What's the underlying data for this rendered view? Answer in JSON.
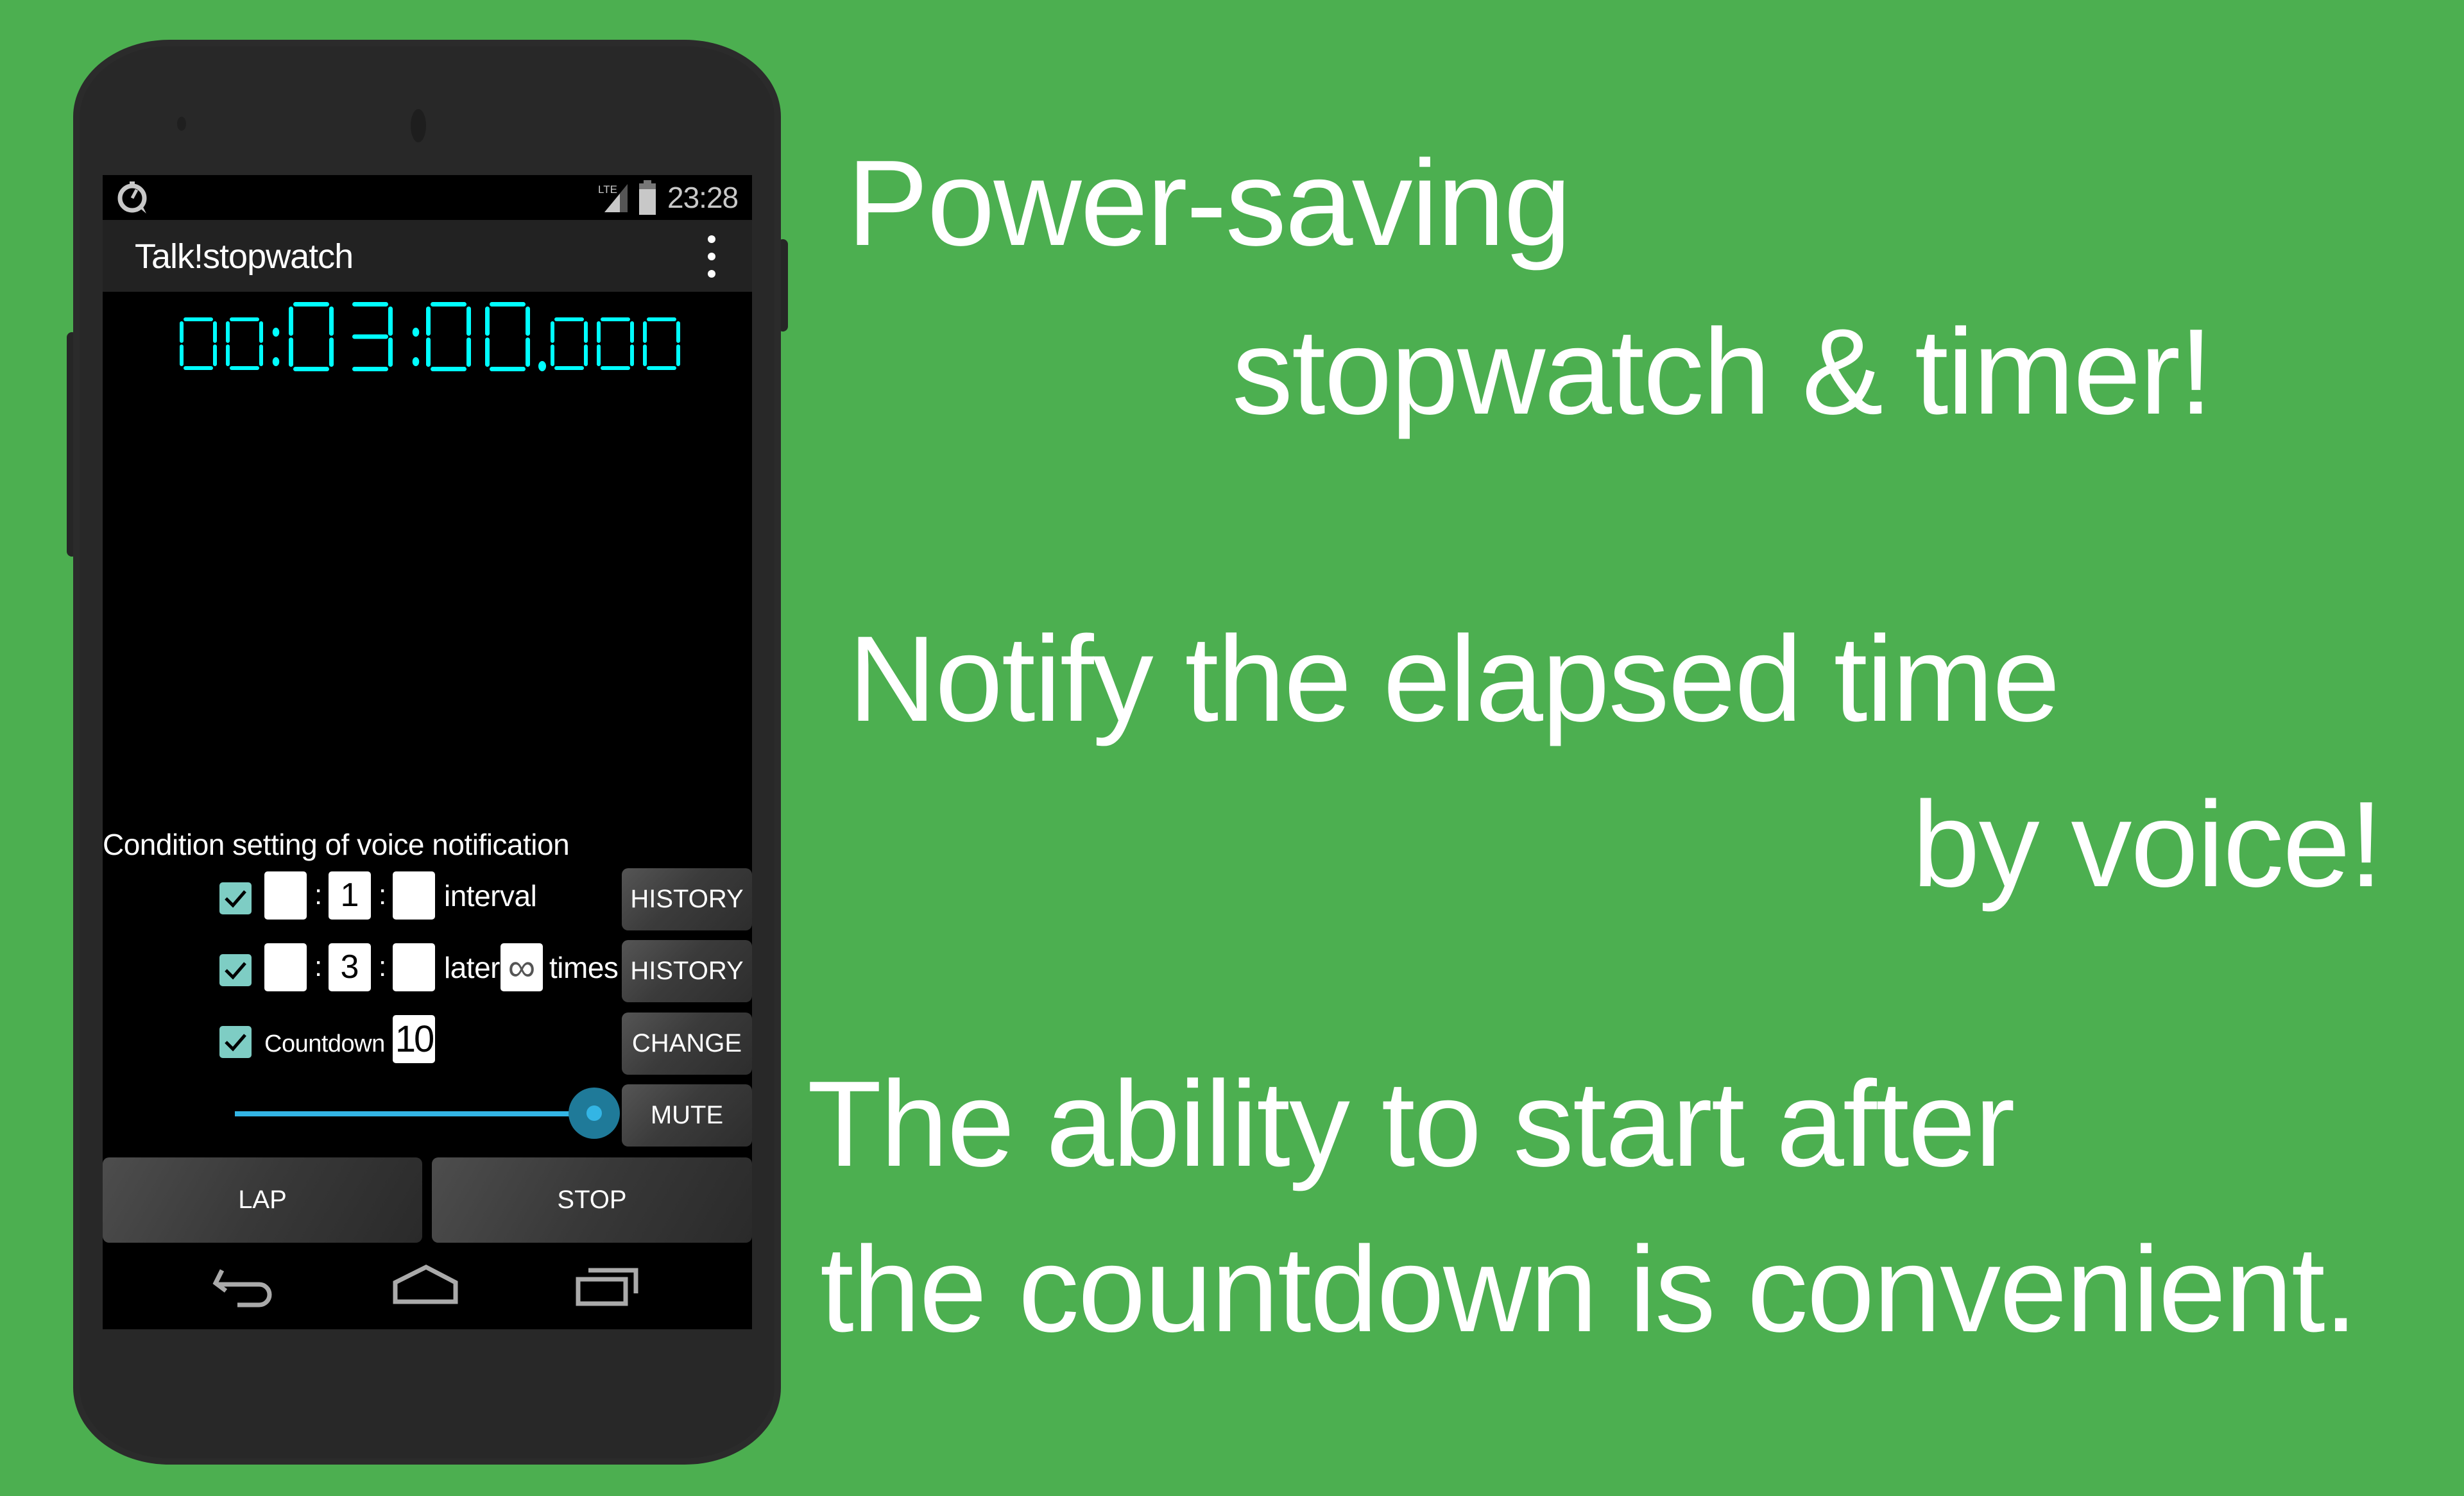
{
  "background_color": "#4CAF50",
  "phone": {
    "status_bar": {
      "app_icon": "stopwatch-notification-icon",
      "network_label": "LTE",
      "time": "23:28"
    },
    "app_bar": {
      "title": "Talk!stopwatch",
      "menu_icon": "overflow-menu-icon"
    },
    "timer": {
      "hours": "00",
      "minutes": "03",
      "seconds": "00",
      "milliseconds": "000",
      "display_text": "00:03:00.000",
      "color": "#00FFFF"
    },
    "conditions": {
      "title": "Condition setting of voice notification",
      "interval_row": {
        "checked": true,
        "hours": "",
        "minutes": "1",
        "seconds": "",
        "separator": ":",
        "label": "interval",
        "button": "HISTORY"
      },
      "later_row": {
        "checked": true,
        "hours": "",
        "minutes": "3",
        "seconds": "",
        "separator": ":",
        "label_later": "later",
        "times_value": "∞",
        "label_times": "times",
        "button": "HISTORY"
      },
      "countdown_row": {
        "checked": true,
        "label": "Countdown",
        "value": "10",
        "button": "CHANGE"
      },
      "volume": {
        "level_percent": 100,
        "button": "MUTE"
      }
    },
    "actions": {
      "lap": "LAP",
      "stop": "STOP"
    },
    "nav_bar": {
      "back": "back-icon",
      "home": "home-icon",
      "recents": "recents-icon"
    },
    "accent_checkbox": "#7ECDC4",
    "accent_slider": "#33B5E5"
  },
  "promo": {
    "line1": "Power-saving",
    "line2": "stopwatch & timer!",
    "line3": "Notify the elapsed time",
    "line4": "by voice!",
    "line5": "The ability to start after",
    "line6": "the countdown is convenient."
  }
}
